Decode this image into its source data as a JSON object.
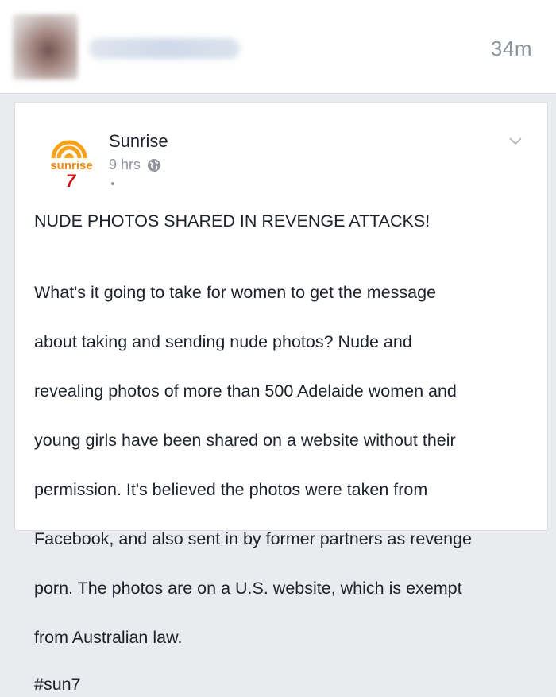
{
  "notification": {
    "time_ago": "34m"
  },
  "post": {
    "page_name": "Sunrise",
    "logo": {
      "wordmark": "sunrise",
      "numeral": "7",
      "colors": {
        "sun": "#f7a21b",
        "text": "#f28c12",
        "seven": "#d0121b"
      }
    },
    "timestamp": "9 hrs",
    "privacy_icon": "globe-icon",
    "menu_icon": "chevron-down-icon",
    "headline": "NUDE PHOTOS SHARED IN REVENGE ATTACKS!",
    "body_lines": [
      "What's it going to take for women to get the message",
      "about taking and sending nude photos? Nude and",
      "revealing photos of more than 500 Adelaide women and",
      "young girls have been shared on a website without their",
      "permission. It's believed the photos were taken from",
      "Facebook, and also sent in by former partners as revenge",
      "porn. The photos are on a U.S. website, which is exempt",
      "from Australian law."
    ],
    "hashtag": "#sun7"
  }
}
